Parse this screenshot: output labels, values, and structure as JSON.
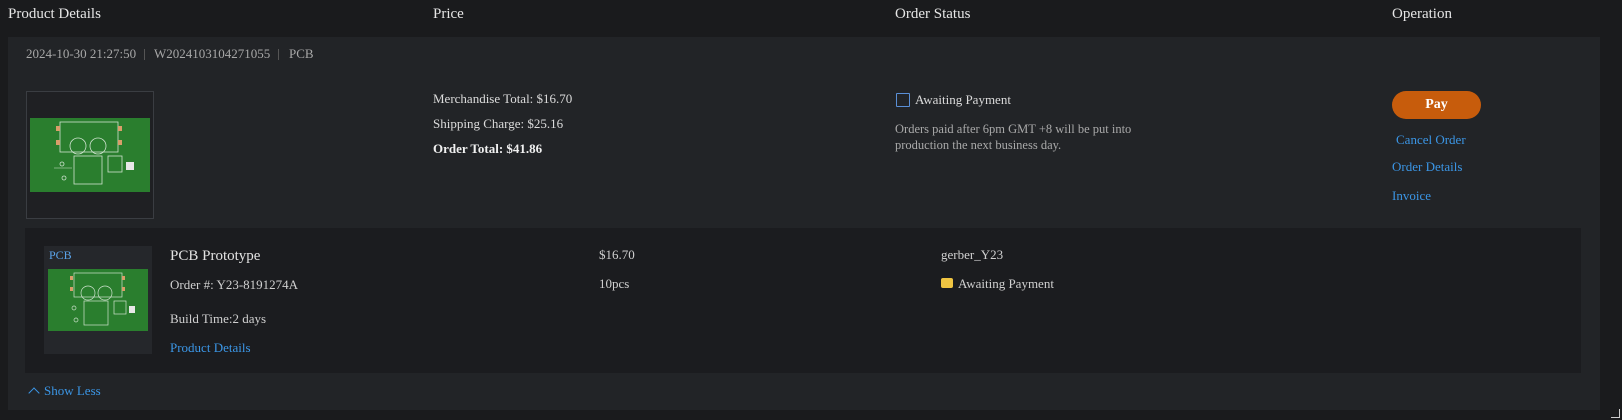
{
  "header": {
    "product_details": "Product Details",
    "price": "Price",
    "order_status": "Order Status",
    "operation": "Operation"
  },
  "order": {
    "datetime": "2024-10-30 21:27:50",
    "order_id": "W2024103104271055",
    "category": "PCB",
    "price": {
      "merchandise_total": "Merchandise Total: $16.70",
      "shipping_charge": "Shipping Charge: $25.16",
      "order_total": "Order Total: $41.86"
    },
    "status": {
      "label": "Awaiting Payment",
      "note": "Orders paid after 6pm GMT +8 will be put into production the next business day."
    },
    "operations": {
      "pay": "Pay",
      "cancel": "Cancel Order",
      "details": "Order Details",
      "invoice": "Invoice"
    }
  },
  "item": {
    "tag": "PCB",
    "title": "PCB Prototype",
    "order_number": "Order #: Y23-8191274A",
    "build_time": "Build Time:2 days",
    "details_link": "Product Details",
    "price": "$16.70",
    "quantity": "10pcs",
    "file": "gerber_Y23",
    "status": "Awaiting Payment"
  },
  "footer": {
    "show_less": "Show Less"
  },
  "colors": {
    "accent_link": "#3b96e6",
    "pay_button": "#c75c0c",
    "pcb_green": "#2a7e2e",
    "background": "#1a1b1d"
  }
}
